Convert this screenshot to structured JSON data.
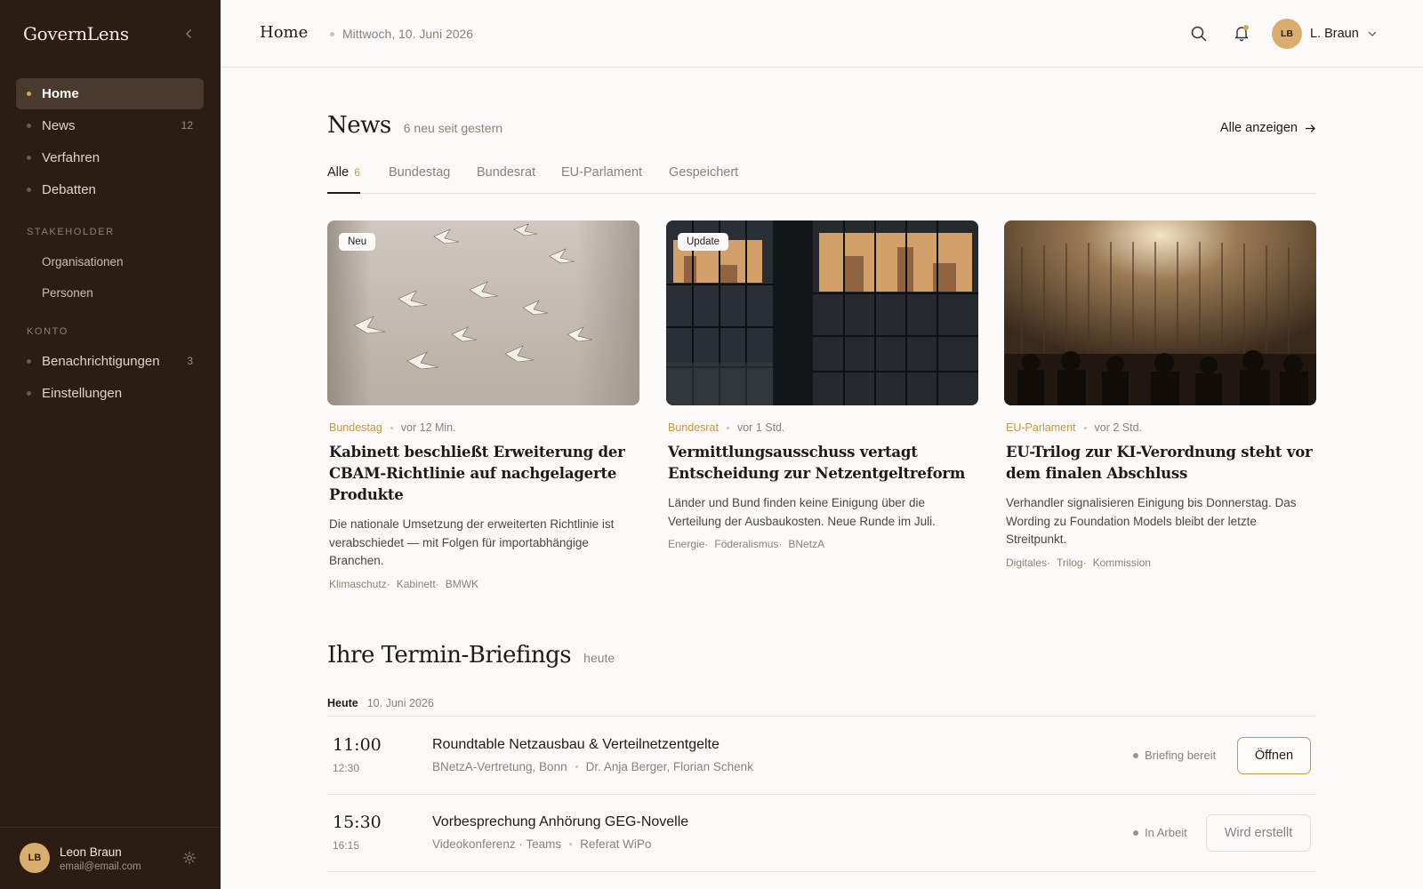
{
  "sidebar": {
    "brand": "GovernLens",
    "nav": [
      {
        "label": "Home"
      },
      {
        "label": "News",
        "count": "12"
      },
      {
        "label": "Verfahren"
      },
      {
        "label": "Debatten"
      }
    ],
    "stakeholder_label": "STAKEHOLDER",
    "stakeholder_items": [
      "Organisationen",
      "Personen"
    ],
    "konto_label": "KONTO",
    "konto_items": [
      {
        "label": "Benachrichtigungen",
        "count": "3"
      },
      {
        "label": "Einstellungen"
      }
    ],
    "user": {
      "initials": "LB",
      "name": "Leon Braun",
      "email": "email@email.com"
    }
  },
  "topbar": {
    "title": "Home",
    "date": "Mittwoch, 10. Juni 2026",
    "user_initials": "LB",
    "user_name": "L. Braun"
  },
  "news": {
    "title": "News",
    "subtitle": "6 neu seit gestern",
    "see_all": "Alle anzeigen",
    "tabs": [
      {
        "label": "Alle",
        "count": "6"
      },
      {
        "label": "Bundestag"
      },
      {
        "label": "Bundesrat"
      },
      {
        "label": "EU-Parlament"
      },
      {
        "label": "Gespeichert"
      }
    ],
    "cards": [
      {
        "badge": "Neu",
        "source": "Bundestag",
        "time": "vor 12 Min.",
        "title": "Kabinett beschließt Erweiterung der CBAM-Richtlinie auf nachgelagerte Produkte",
        "desc": "Die nationale Umsetzung der erweiterten Richtlinie ist verabschiedet — mit Folgen für importabhängige Branchen.",
        "tags": [
          "Klimaschutz·",
          "Kabinett·",
          "BMWK"
        ]
      },
      {
        "badge": "Update",
        "source": "Bundesrat",
        "time": "vor 1 Std.",
        "title": "Vermittlungsausschuss vertagt Entscheidung zur Netzentgeltreform",
        "desc": "Länder und Bund finden keine Einigung über die Verteilung der Ausbaukosten. Neue Runde im Juli.",
        "tags": [
          "Energie·",
          "Föderalismus·",
          "BNetzA"
        ]
      },
      {
        "source": "EU-Parlament",
        "time": "vor 2 Std.",
        "title": "EU-Trilog zur KI-Verordnung steht vor dem finalen Abschluss",
        "desc": "Verhandler signalisieren Einigung bis Donnerstag. Das Wording zu Foundation Models bleibt der letzte Streitpunkt.",
        "tags": [
          "Digitales·",
          "Trilog·",
          "Kommission"
        ]
      }
    ]
  },
  "briefings": {
    "title": "Ihre Termin-Briefings",
    "subtitle": "heute",
    "day_label": "Heute",
    "day_date": "10. Juni 2026",
    "rows": [
      {
        "start": "11:00",
        "end": "12:30",
        "title": "Roundtable Netzausbau & Verteilnetzentgelte",
        "location": "BNetzA-Vertretung, Bonn",
        "people": "Dr. Anja Berger, Florian Schenk",
        "status": "Briefing bereit",
        "action": "Öffnen"
      },
      {
        "start": "15:30",
        "end": "16:15",
        "title": "Vorbesprechung Anhörung GEG-Novelle",
        "location": "Videokonferenz · Teams",
        "people": "Referat WiPo",
        "status": "In Arbeit",
        "action": "Wird erstellt"
      }
    ]
  },
  "colors": {
    "sidebar_bg": "#2b1d14",
    "accent": "#c9963f",
    "avatar": "#d8ad6e"
  }
}
